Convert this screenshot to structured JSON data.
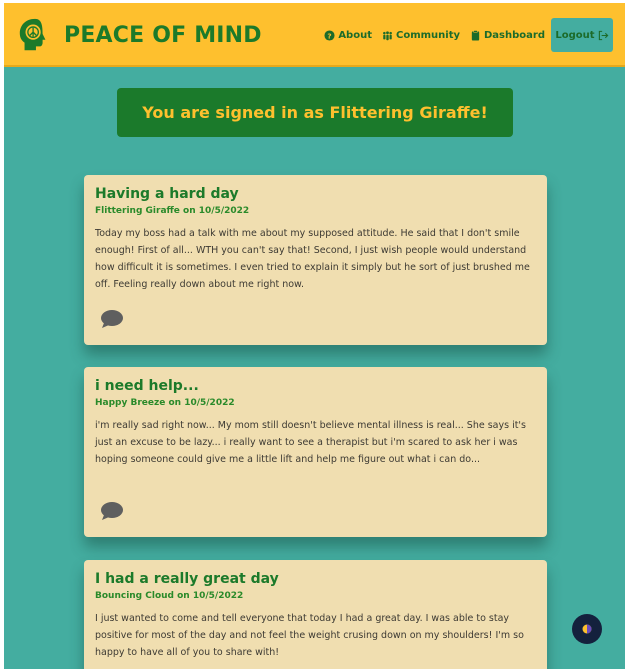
{
  "brand": {
    "name": "PEACE OF MIND",
    "logo_icon": "head-peace-icon"
  },
  "nav": {
    "about": "About",
    "community": "Community",
    "dashboard": "Dashboard",
    "logout": "Logout"
  },
  "banner": {
    "text": "You are signed in as Flittering Giraffe!"
  },
  "posts": [
    {
      "title": "Having a hard day",
      "meta": "Flittering Giraffe on 10/5/2022",
      "body": "Today my boss had a talk with me about my supposed attitude. He said that I don't smile enough! First of all... WTH you can't say that! Second, I just wish people would understand how difficult it is sometimes. I even tried to explain it simply but he sort of just brushed me off. Feeling really down about me right now."
    },
    {
      "title": "i need help...",
      "meta": "Happy Breeze on 10/5/2022",
      "body": "i'm really sad right now... My mom still doesn't believe mental illness is real... She says it's just an excuse to be lazy... i really want to see a therapist but i'm scared to ask her i was hoping someone could give me a little lift and help me figure out what i can do..."
    },
    {
      "title": "I had a really great day",
      "meta": "Bouncing Cloud on 10/5/2022",
      "body": "I just wanted to come and tell everyone that today I had a great day. I was able to stay positive for most of the day and not feel the weight crusing down on my shoulders! I'm so happy to have all of you to share with!"
    }
  ],
  "colors": {
    "navbar": "#fec02e",
    "background": "#44ada0",
    "brand_green": "#1c7a2a",
    "banner_bg": "#1b7a2b",
    "card_bg": "#f0deb0"
  }
}
